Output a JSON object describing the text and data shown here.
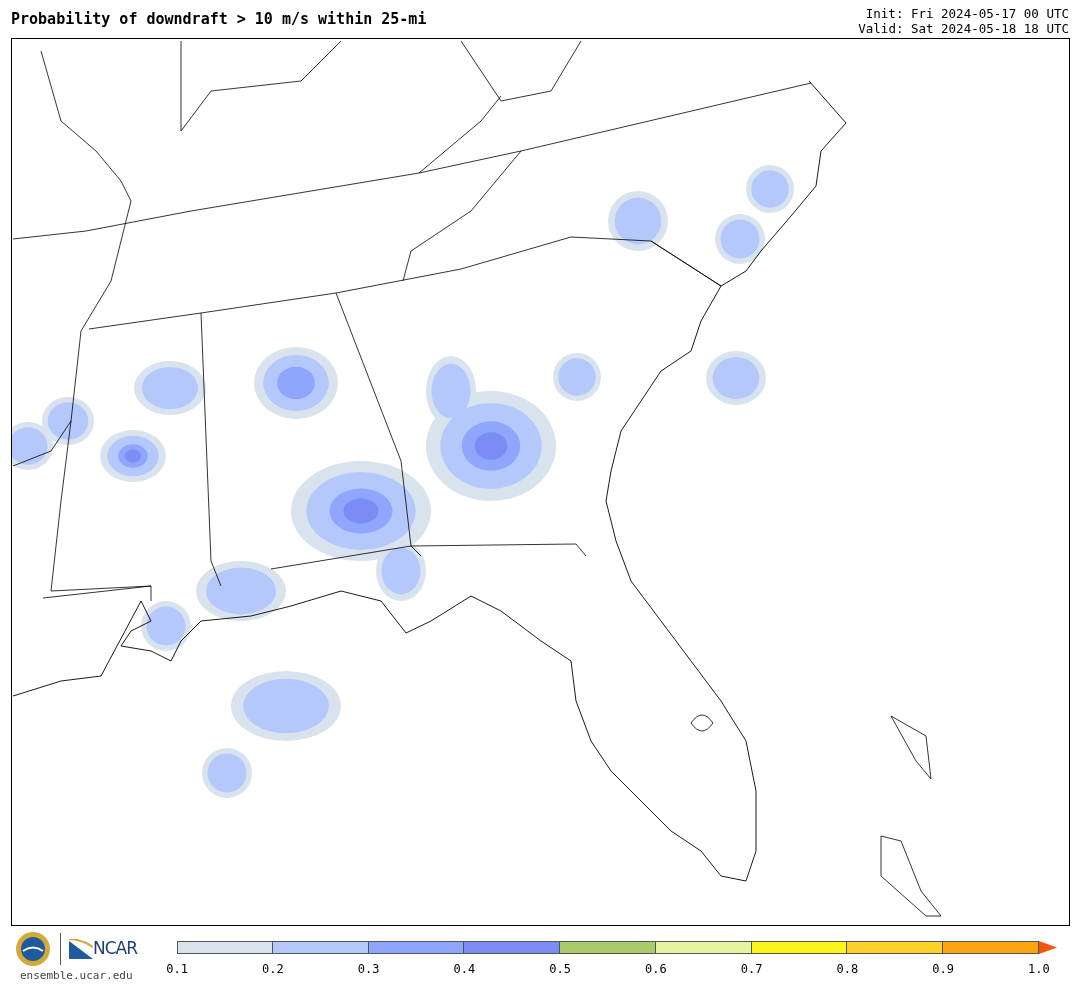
{
  "title": "Probability of downdraft > 10 m/s within 25-mi",
  "init": "Init: Fri 2024-05-17 00 UTC",
  "valid": "Valid: Sat 2024-05-18 18 UTC",
  "footer": {
    "logo_text": "NCAR",
    "site": "ensemble.ucar.edu"
  },
  "colorbar": {
    "bins": [
      {
        "color": "#d9e3ee"
      },
      {
        "color": "#b5c8fc"
      },
      {
        "color": "#8ea6fc"
      },
      {
        "color": "#7b8cf5"
      },
      {
        "color": "#a8cc6c"
      },
      {
        "color": "#e6f5a0"
      },
      {
        "color": "#fcf51c"
      },
      {
        "color": "#fdd12a"
      },
      {
        "color": "#fca412"
      }
    ],
    "extend": {
      "color": "#f2560e"
    },
    "ticks": [
      "0.1",
      "0.2",
      "0.3",
      "0.4",
      "0.5",
      "0.6",
      "0.7",
      "0.8",
      "0.9",
      "1.0"
    ]
  }
}
